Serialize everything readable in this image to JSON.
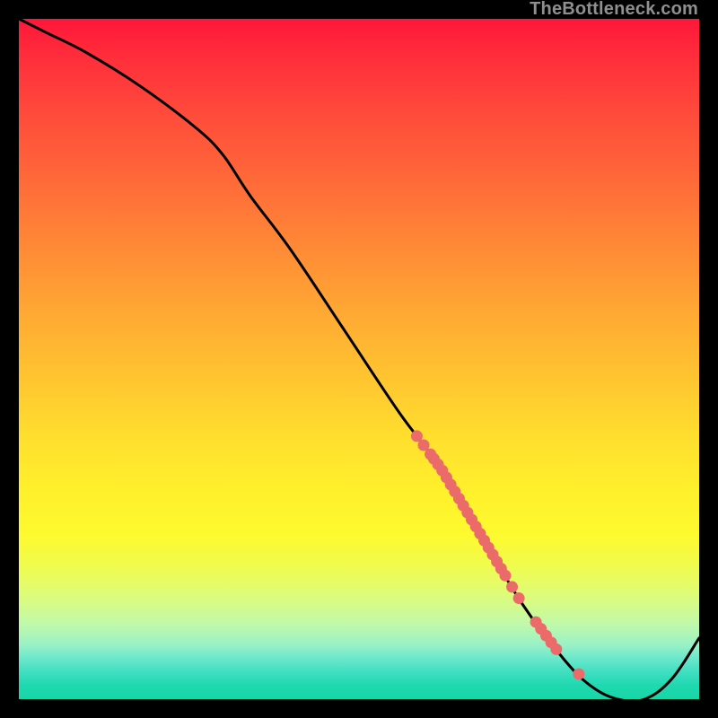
{
  "watermark": "TheBottleneck.com",
  "colors": {
    "line": "#000000",
    "markers": "#eb6a6a",
    "gradient_top": "#ff173a",
    "gradient_bottom": "#18d6a6"
  },
  "chart_data": {
    "type": "line",
    "title": "",
    "xlabel": "",
    "ylabel": "",
    "xlim": [
      0,
      100
    ],
    "ylim": [
      0,
      100
    ],
    "grid": false,
    "legend": false,
    "x": [
      0,
      4,
      10,
      18,
      26,
      30,
      34,
      40,
      48,
      56,
      62,
      68,
      74,
      80,
      84,
      88,
      92,
      96,
      100
    ],
    "values": [
      100,
      98,
      95,
      90,
      84,
      80,
      74,
      66,
      54,
      42,
      34,
      24,
      14,
      6,
      2,
      0,
      0,
      3,
      9
    ],
    "marker_clusters": [
      {
        "x_start": 58.5,
        "x_end": 60.5,
        "count": 3
      },
      {
        "x_start": 61.0,
        "x_end": 71.5,
        "count": 18
      },
      {
        "x_start": 72.5,
        "x_end": 73.5,
        "count": 2
      },
      {
        "x_start": 76.0,
        "x_end": 79.0,
        "count": 5
      },
      {
        "x_start": 82.0,
        "x_end": 82.6,
        "count": 1
      }
    ]
  }
}
